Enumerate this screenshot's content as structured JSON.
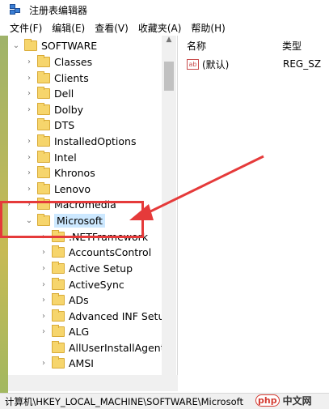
{
  "window": {
    "title": "注册表编辑器"
  },
  "menu": [
    "文件(F)",
    "编辑(E)",
    "查看(V)",
    "收藏夹(A)",
    "帮助(H)"
  ],
  "tree": {
    "root": {
      "label": "SOFTWARE",
      "expander": "⌄"
    },
    "items": [
      {
        "label": "Classes",
        "expander": "›"
      },
      {
        "label": "Clients",
        "expander": "›"
      },
      {
        "label": "Dell",
        "expander": "›"
      },
      {
        "label": "Dolby",
        "expander": "›"
      },
      {
        "label": "DTS",
        "expander": ""
      },
      {
        "label": "InstalledOptions",
        "expander": "›"
      },
      {
        "label": "Intel",
        "expander": "›"
      },
      {
        "label": "Khronos",
        "expander": "›"
      },
      {
        "label": "Lenovo",
        "expander": "›"
      },
      {
        "label": "Macromedia",
        "expander": "›"
      },
      {
        "label": "Microsoft",
        "expander": "⌄",
        "selected": true
      }
    ],
    "children": [
      {
        "label": ".NETFramework",
        "expander": "›"
      },
      {
        "label": "AccountsControl",
        "expander": "›"
      },
      {
        "label": "Active Setup",
        "expander": "›"
      },
      {
        "label": "ActiveSync",
        "expander": "›"
      },
      {
        "label": "ADs",
        "expander": "›"
      },
      {
        "label": "Advanced INF Setup",
        "expander": "›"
      },
      {
        "label": "ALG",
        "expander": "›"
      },
      {
        "label": "AllUserInstallAgent",
        "expander": ""
      },
      {
        "label": "AMSI",
        "expander": "›"
      }
    ]
  },
  "values": {
    "columns": {
      "name": "名称",
      "type": "类型"
    },
    "rows": [
      {
        "icon": "ab",
        "name": "(默认)",
        "type": "REG_SZ"
      }
    ]
  },
  "status": {
    "path": "计算机\\HKEY_LOCAL_MACHINE\\SOFTWARE\\Microsoft"
  },
  "watermark": {
    "logo": "php",
    "text": "中文网"
  },
  "annotation": {
    "color": "#e53a3a"
  }
}
